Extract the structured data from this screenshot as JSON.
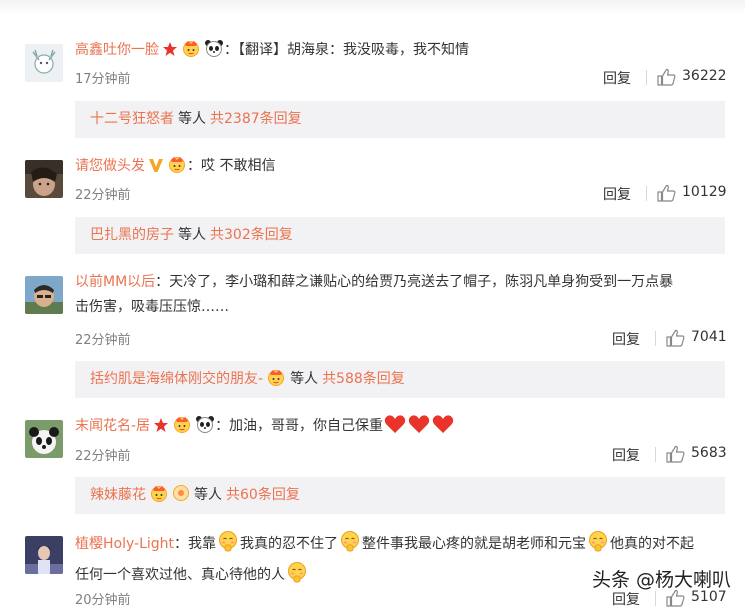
{
  "comments": [
    {
      "username": "高鑫吐你一脸",
      "text_lines": [
        "：【翻译】胡海泉：我没吸毒，我不知情"
      ],
      "time": "17分钟前",
      "reply_label": "回复",
      "likes": "36222",
      "replies": {
        "user": "十二号狂怒者",
        "mid": "等人",
        "count": "共2387条回复"
      }
    },
    {
      "username": "请您做头发",
      "text_lines": [
        "：哎 不敢相信"
      ],
      "time": "22分钟前",
      "reply_label": "回复",
      "likes": "10129",
      "replies": {
        "user": "巴扎黑的房子",
        "mid": "等人",
        "count": "共302条回复"
      }
    },
    {
      "username": "以前MM以后",
      "text_lines": [
        "：天冷了，李小璐和薛之谦贴心的给贾乃亮送去了帽子，陈羽凡单身狗受到一万点暴",
        "击伤害，吸毒压压惊……"
      ],
      "time": "22分钟前",
      "reply_label": "回复",
      "likes": "7041",
      "replies": {
        "user": "括约肌是海绵体刚交的朋友-",
        "mid": "等人",
        "count": "共588条回复"
      }
    },
    {
      "username": "末闻花名-居",
      "text_lines": [
        "：加油，哥哥，你自己保重"
      ],
      "time": "22分钟前",
      "reply_label": "回复",
      "likes": "5683",
      "replies": {
        "user": "辣妹藤花",
        "mid": "等人",
        "count": "共60条回复"
      }
    },
    {
      "username": "植樱Holy-Light",
      "text_lines": [
        "：我靠",
        "我真的忍不住了",
        "整件事我最心疼的就是胡老师和元宝",
        "他真的对不起",
        "任何一个喜欢过他、真心待他的人"
      ],
      "time": "20分钟前",
      "reply_label": "回复",
      "likes": "5107"
    }
  ],
  "watermark": "头条 @杨大喇叭",
  "colors": {
    "accent": "#eb7350",
    "reply_bg": "#f2f2f5",
    "time": "#808080"
  },
  "icons": [
    "thumbs-up-icon",
    "star-badge-icon",
    "crown-badge-icon",
    "panda-icon",
    "v-badge-icon",
    "heart-icon",
    "shy-face-icon"
  ]
}
